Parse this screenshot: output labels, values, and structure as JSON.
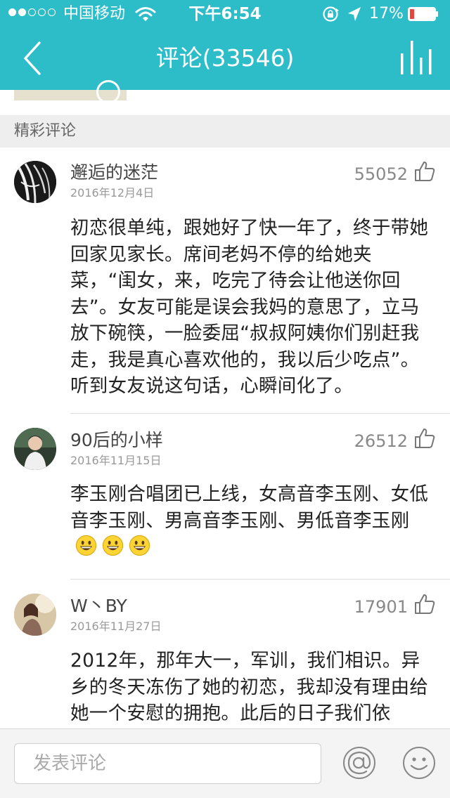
{
  "status_bar": {
    "carrier": "中国移动",
    "time": "下午6:54",
    "battery_pct": "17%",
    "battery_level": 0.17,
    "signal_strength": 2,
    "signal_max": 5
  },
  "nav": {
    "title": "评论(33546)",
    "back_icon": "chevron-left-icon",
    "stats_icon": "bar-chart-icon"
  },
  "section": {
    "label": "精彩评论"
  },
  "comments": [
    {
      "username": "邂逅的迷茫",
      "date": "2016年12月4日",
      "likes": "55052",
      "text": "初恋很单纯，跟她好了快一年了，终于带她回家见家长。席间老妈不停的给她夹菜，“闺女，来，吃完了待会让他送你回去”。女友可能是误会我妈的意思了，立马放下碗筷，一脸委屈“叔叔阿姨你们别赶我走，我是真心喜欢他的，我以后少吃点”。听到女友说这句话，心瞬间化了。"
    },
    {
      "username": "90后的小样",
      "date": "2016年11月15日",
      "likes": "26512",
      "text": "李玉刚合唱团已上线，女高音李玉刚、女低音李玉刚、男高音李玉刚、男低音李玉刚",
      "emoji_count": 3
    },
    {
      "username": "W丶BY",
      "date": "2016年11月27日",
      "likes": "17901",
      "text": "2012年，那年大一，军训，我们相识。异乡的冬天冻伤了她的初恋，我却没有理由给她一个安慰的拥抱。此后的日子我们依"
    }
  ],
  "composer": {
    "placeholder": "发表评论",
    "at_icon": "at-sign-icon",
    "emoji_icon": "smiley-icon"
  },
  "colors": {
    "accent": "#2cbdc8",
    "section_bg": "#eeeeee",
    "battery_low": "#e8453c"
  }
}
